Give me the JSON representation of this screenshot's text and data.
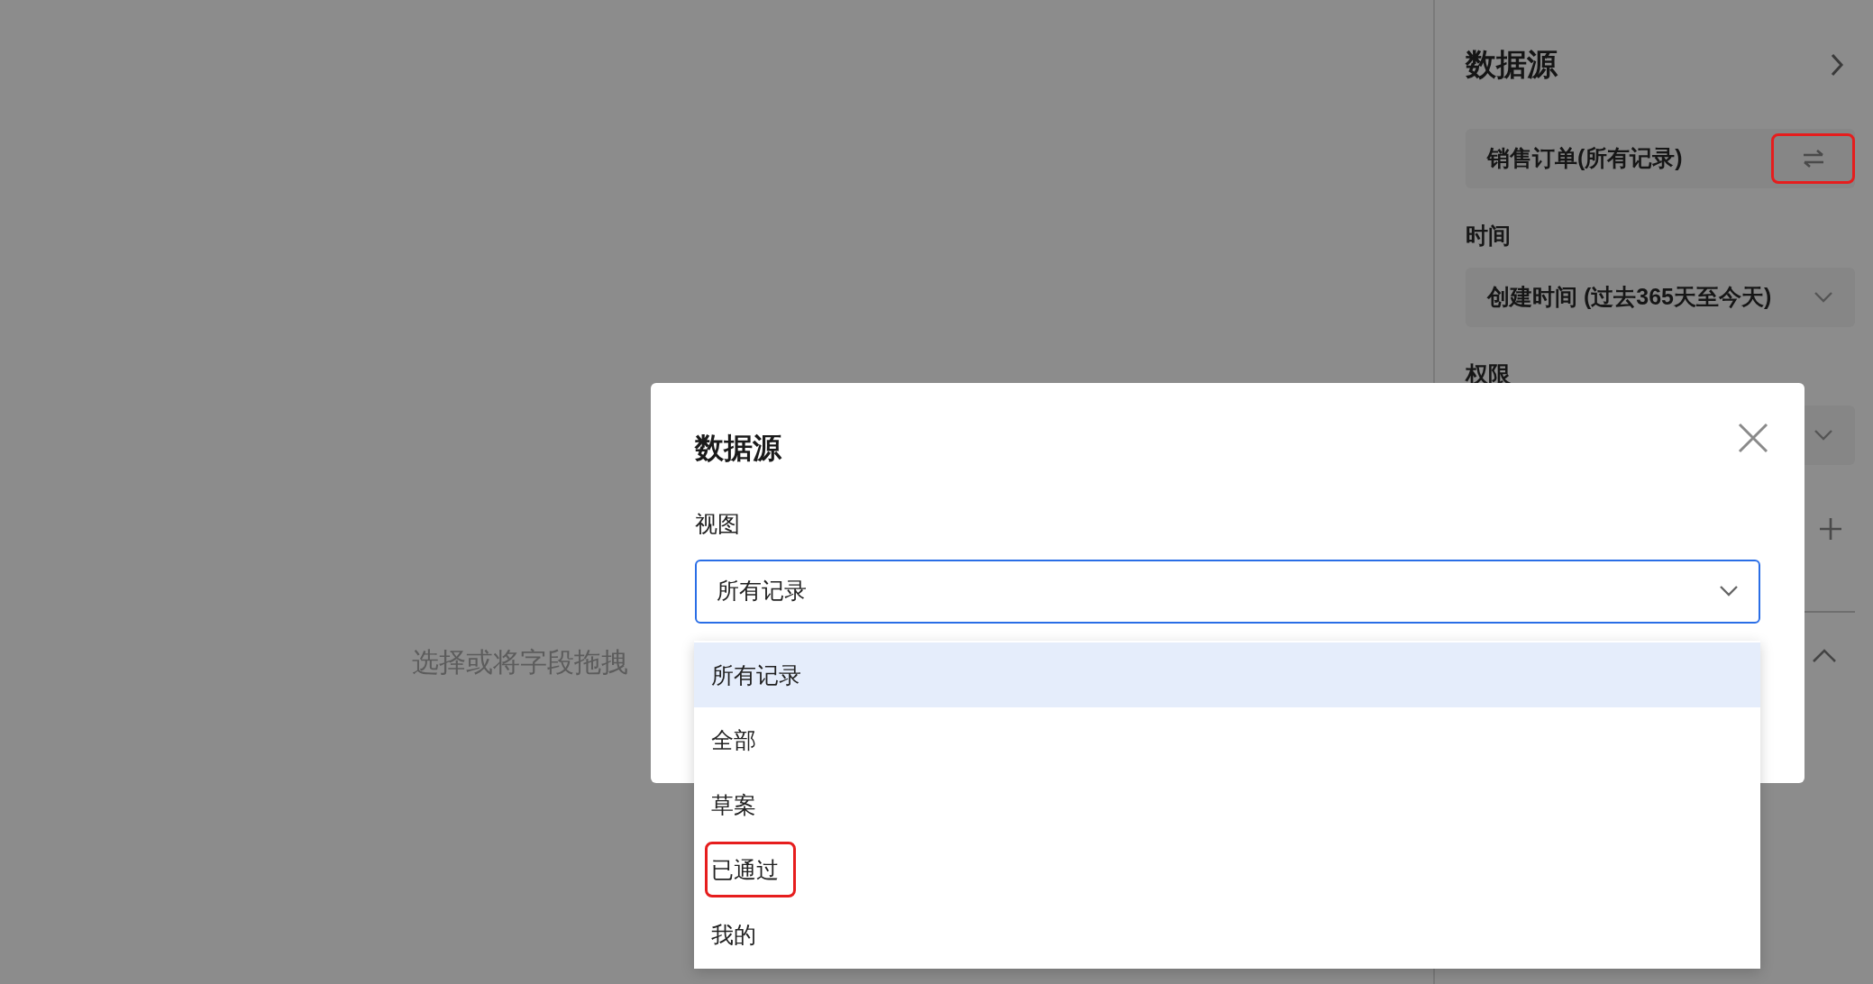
{
  "canvas": {
    "hint": "选择或将字段拖拽"
  },
  "panel": {
    "title": "数据源",
    "sections": [
      {
        "kind": "source",
        "value": "销售订单(所有记录)",
        "highlighted": true
      },
      {
        "kind": "select",
        "label": "时间",
        "value": "创建时间 (过去365天至今天)"
      },
      {
        "kind": "select",
        "label": "权限"
      },
      {
        "kind": "add"
      },
      {
        "kind": "collapse"
      }
    ]
  },
  "dialog": {
    "title": "数据源",
    "field_label": "视图",
    "value": "所有记录",
    "options": [
      {
        "label": "所有记录",
        "selected": true,
        "highlighted": false
      },
      {
        "label": "全部",
        "selected": false,
        "highlighted": false
      },
      {
        "label": "草案",
        "selected": false,
        "highlighted": false
      },
      {
        "label": "已通过",
        "selected": false,
        "highlighted": true
      },
      {
        "label": "我的",
        "selected": false,
        "highlighted": false
      }
    ]
  }
}
